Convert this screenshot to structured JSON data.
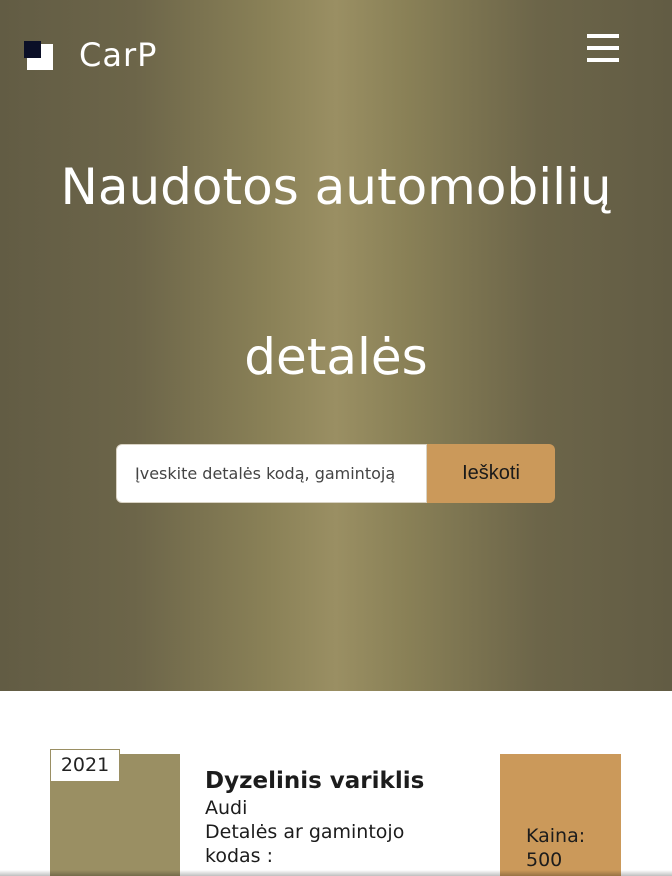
{
  "header": {
    "logo_text": "CarP",
    "menu_icon": "hamburger-menu-icon"
  },
  "hero": {
    "title_line1": "Naudotos automobilių",
    "title_line2": "detalės",
    "search": {
      "placeholder": "Įveskite detalės kodą, gamintoją",
      "value": "",
      "button_label": "Ieškoti"
    }
  },
  "listing": {
    "items": [
      {
        "year": "2021",
        "title": "Dyzelinis variklis",
        "brand": "Audi",
        "code_label": "Detalės ar gamintojo kodas :",
        "price_label": "Kaina:",
        "price_value": "500"
      }
    ]
  },
  "colors": {
    "hero_base": "#625c44",
    "hero_highlight": "#9a8f63",
    "accent": "#cb995a",
    "logo_dark": "#0b0f27",
    "text_white": "#ffffff",
    "text_dark": "#1c1c1c"
  }
}
